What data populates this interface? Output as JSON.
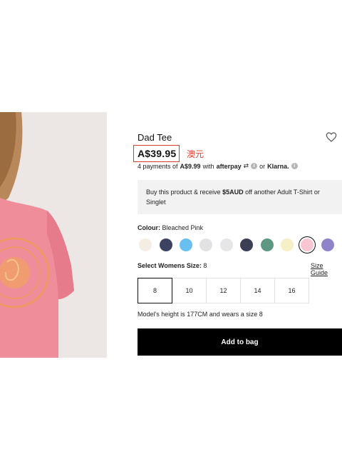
{
  "product": {
    "title": "Dad Tee",
    "price": "A$39.95",
    "price_note": "澳元",
    "installments": {
      "prefix": "4 payments of",
      "amount": "A$9.99",
      "with": "with",
      "afterpay": "afterpay",
      "or": "or",
      "klarna": "Klarna."
    },
    "promo": {
      "prefix": "Buy this product & receive",
      "highlight": "$5AUD",
      "suffix": "off another Adult T-Shirt or Singlet"
    },
    "colour": {
      "label": "Colour:",
      "value": "Bleached Pink",
      "swatches": [
        {
          "color": "#f4ede3"
        },
        {
          "color": "#3c4261"
        },
        {
          "color": "#69c0f0"
        },
        {
          "color": "#e2e2e4"
        },
        {
          "color": "#e6e6e8"
        },
        {
          "color": "#3a3f55"
        },
        {
          "color": "#5f9882"
        },
        {
          "color": "#f7efc5"
        },
        {
          "color": "#f8c6d3",
          "selected": true
        },
        {
          "color": "#8f84c9"
        }
      ]
    },
    "size": {
      "label": "Select Womens Size:",
      "value": "8",
      "guide": "Size Guide",
      "options": [
        "8",
        "10",
        "12",
        "14",
        "16"
      ],
      "selected": "8"
    },
    "model_note": "Model's height is 177CM and wears a size 8",
    "add_to_bag": "Add to bag"
  }
}
